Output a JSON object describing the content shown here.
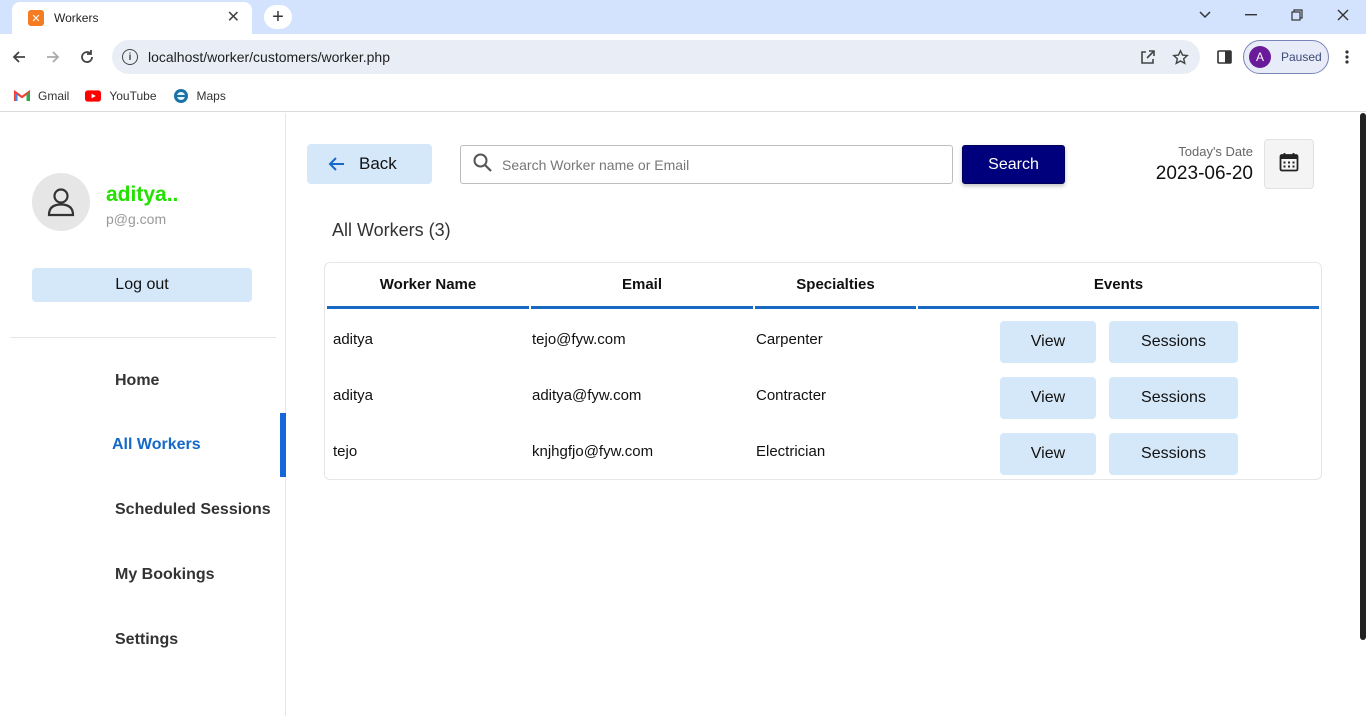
{
  "browser": {
    "tab_title": "Workers",
    "url": "localhost/worker/customers/worker.php",
    "profile_initial": "A",
    "profile_status": "Paused",
    "bookmarks": [
      {
        "label": "Gmail",
        "icon": "gmail-icon"
      },
      {
        "label": "YouTube",
        "icon": "youtube-icon"
      },
      {
        "label": "Maps",
        "icon": "maps-icon"
      }
    ]
  },
  "sidebar": {
    "user_name": "aditya..",
    "user_email": "p@g.com",
    "logout_label": "Log out",
    "menu": [
      {
        "label": "Home",
        "active": false
      },
      {
        "label": "All Workers",
        "active": true
      },
      {
        "label": "Scheduled Sessions",
        "active": false
      },
      {
        "label": "My Bookings",
        "active": false
      },
      {
        "label": "Settings",
        "active": false
      }
    ],
    "active_color": "#1566d6",
    "user_name_color": "#22e000"
  },
  "header": {
    "back_label": "Back",
    "search_placeholder": "Search Worker name or Email",
    "search_value": "",
    "search_button_label": "Search",
    "date_label": "Today's Date",
    "date_value": "2023-06-20"
  },
  "workers": {
    "title": "All Workers (3)",
    "columns": [
      "Worker Name",
      "Email",
      "Specialties",
      "Events"
    ],
    "rows": [
      {
        "name": "aditya",
        "email": "tejo@fyw.com",
        "specialty": "Carpenter",
        "view_label": "View",
        "sessions_label": "Sessions"
      },
      {
        "name": "aditya",
        "email": "aditya@fyw.com",
        "specialty": "Contracter",
        "view_label": "View",
        "sessions_label": "Sessions"
      },
      {
        "name": "tejo",
        "email": "knjhgfjo@fyw.com",
        "specialty": "Electrician",
        "view_label": "View",
        "sessions_label": "Sessions"
      }
    ]
  },
  "colors": {
    "accent_light": "#d5e8fa",
    "search_button": "#00007c",
    "table_header_rule": "#1769c4"
  }
}
